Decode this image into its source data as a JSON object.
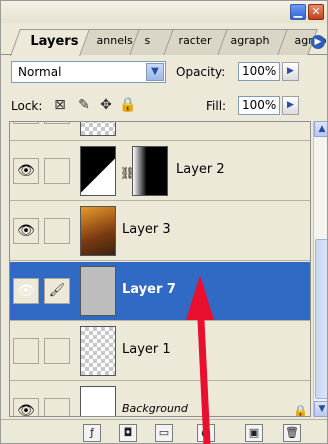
{
  "tabs": [
    {
      "label": "Layers"
    },
    {
      "label": "annels"
    },
    {
      "label": "s"
    },
    {
      "label": "racter"
    },
    {
      "label": "agraph"
    }
  ],
  "blend_mode": "Normal",
  "opacity": {
    "label": "Opacity:",
    "value": "100%"
  },
  "lock": {
    "label": "Lock:"
  },
  "fill": {
    "label": "Fill:",
    "value": "100%"
  },
  "layers": [
    {
      "name": "",
      "visible": false
    },
    {
      "name": "Layer 2",
      "visible": true
    },
    {
      "name": "Layer 3",
      "visible": true
    },
    {
      "name": "Layer 7",
      "visible": true,
      "selected": true
    },
    {
      "name": "Layer 1",
      "visible": false
    },
    {
      "name": "Background",
      "visible": true,
      "locked": true
    }
  ],
  "colors": {
    "selection": "#316AC5",
    "panel": "#ECE9D8",
    "annotation_arrow": "#E8102E"
  }
}
